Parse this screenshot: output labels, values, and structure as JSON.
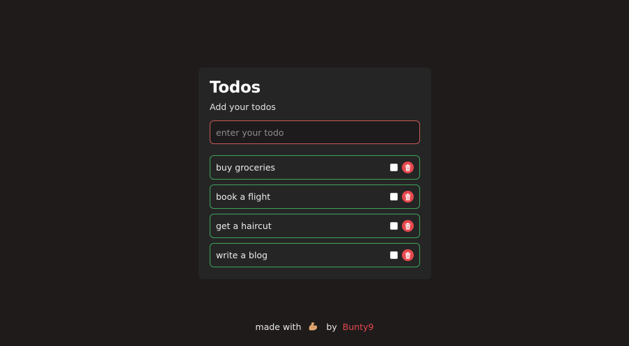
{
  "card": {
    "title": "Todos",
    "subtitle": "Add your todos"
  },
  "input": {
    "placeholder": "enter your todo",
    "value": ""
  },
  "todos": [
    {
      "text": "buy groceries",
      "done": false
    },
    {
      "text": "book a flight",
      "done": false
    },
    {
      "text": "get a haircut",
      "done": false
    },
    {
      "text": "write a blog",
      "done": false
    }
  ],
  "footer": {
    "made_with": "made with",
    "emoji_icon": "flexed-biceps-icon",
    "by": "by",
    "author": "Bunty9"
  },
  "colors": {
    "background": "#1f1b1b",
    "card": "#252525",
    "input_border": "#c85a5a",
    "item_border": "#3fa45c",
    "delete": "#e5484d",
    "author": "#e5484d"
  }
}
